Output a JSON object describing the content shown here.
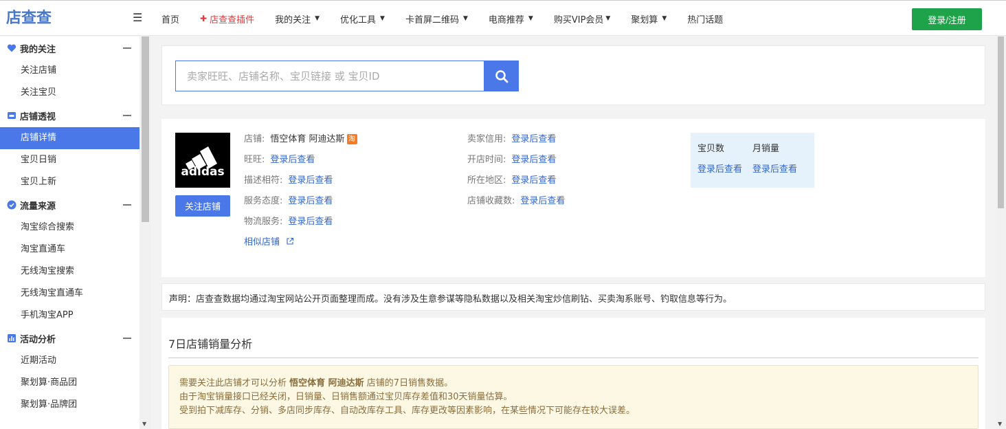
{
  "logo": {
    "text": "店查查"
  },
  "nav": {
    "items": [
      {
        "label": "首页",
        "caret": false,
        "highlight": false
      },
      {
        "label": "店查查插件",
        "caret": false,
        "highlight": true
      },
      {
        "label": "我的关注",
        "caret": true,
        "highlight": false
      },
      {
        "label": "优化工具",
        "caret": true,
        "highlight": false
      },
      {
        "label": "卡首屏二维码",
        "caret": true,
        "highlight": false
      },
      {
        "label": "电商推荐",
        "caret": true,
        "highlight": false
      },
      {
        "label": "购买VIP会员",
        "caret": true,
        "highlight": false
      },
      {
        "label": "聚划算",
        "caret": true,
        "highlight": false
      },
      {
        "label": "热门话题",
        "caret": false,
        "highlight": false
      }
    ],
    "login_label": "登录/注册"
  },
  "sidebar": {
    "groups": [
      {
        "label": "我的关注",
        "icon": "heart-icon",
        "items": [
          {
            "label": "关注店铺"
          },
          {
            "label": "关注宝贝"
          }
        ]
      },
      {
        "label": "店铺透视",
        "icon": "store-icon",
        "items": [
          {
            "label": "店铺详情",
            "active": true
          },
          {
            "label": "宝贝日销"
          },
          {
            "label": "宝贝上新"
          }
        ]
      },
      {
        "label": "流量来源",
        "icon": "check-circle-icon",
        "items": [
          {
            "label": "淘宝综合搜索"
          },
          {
            "label": "淘宝直通车"
          },
          {
            "label": "无线淘宝搜索"
          },
          {
            "label": "无线淘宝直通车"
          },
          {
            "label": "手机淘宝APP"
          }
        ]
      },
      {
        "label": "活动分析",
        "icon": "bar-chart-icon",
        "items": [
          {
            "label": "近期活动"
          },
          {
            "label": "聚划算·商品团"
          },
          {
            "label": "聚划算·品牌团"
          }
        ]
      }
    ]
  },
  "search": {
    "placeholder": "卖家旺旺、店铺名称、宝贝链接 或 宝贝ID"
  },
  "shop": {
    "logo_text": "adidas",
    "follow_label": "关注店铺",
    "name_key": "店铺:",
    "name_value": "悟空体育 阿迪达斯",
    "tao_badge": "淘",
    "left_rows": [
      {
        "key": "旺旺:",
        "value": "登录后查看"
      },
      {
        "key": "描述相符:",
        "value": "登录后查看"
      },
      {
        "key": "服务态度:",
        "value": "登录后查看"
      },
      {
        "key": "物流服务:",
        "value": "登录后查看"
      }
    ],
    "similar_label": "相似店铺",
    "right_rows": [
      {
        "key": "卖家信用:",
        "value": "登录后查看"
      },
      {
        "key": "开店时间:",
        "value": "登录后查看"
      },
      {
        "key": "所在地区:",
        "value": "登录后查看"
      },
      {
        "key": "店铺收藏数:",
        "value": "登录后查看"
      }
    ],
    "stats": {
      "items_label": "宝贝数",
      "items_value": "登录后查看",
      "monthly_label": "月销量",
      "monthly_value": "登录后查看"
    }
  },
  "notice": {
    "text": "声明：店查查数据均通过淘宝网站公开页面整理而成。没有涉及生意参谋等隐私数据以及相关淘宝炒信刷钻、买卖淘系账号、钓取信息等行为。"
  },
  "sales": {
    "title": "7日店铺销量分析",
    "warn_prefix": "需要关注此店铺才可以分析 ",
    "warn_shop": "悟空体育 阿迪达斯",
    "warn_suffix": " 店铺的7日销售数据。",
    "warn_line2": "由于淘宝销量接口已经关闭，日销量、日销售额通过宝贝库存差值和30天销量估算。",
    "warn_line3": "受到拍下减库存、分销、多店同步库存、自动改库存工具、库存更改等因素影响，在某些情况下可能存在较大误差。"
  },
  "colors": {
    "accent": "#4a78e8",
    "login": "#1fa34a",
    "link": "#3366cc",
    "highlight": "#e4393c"
  }
}
